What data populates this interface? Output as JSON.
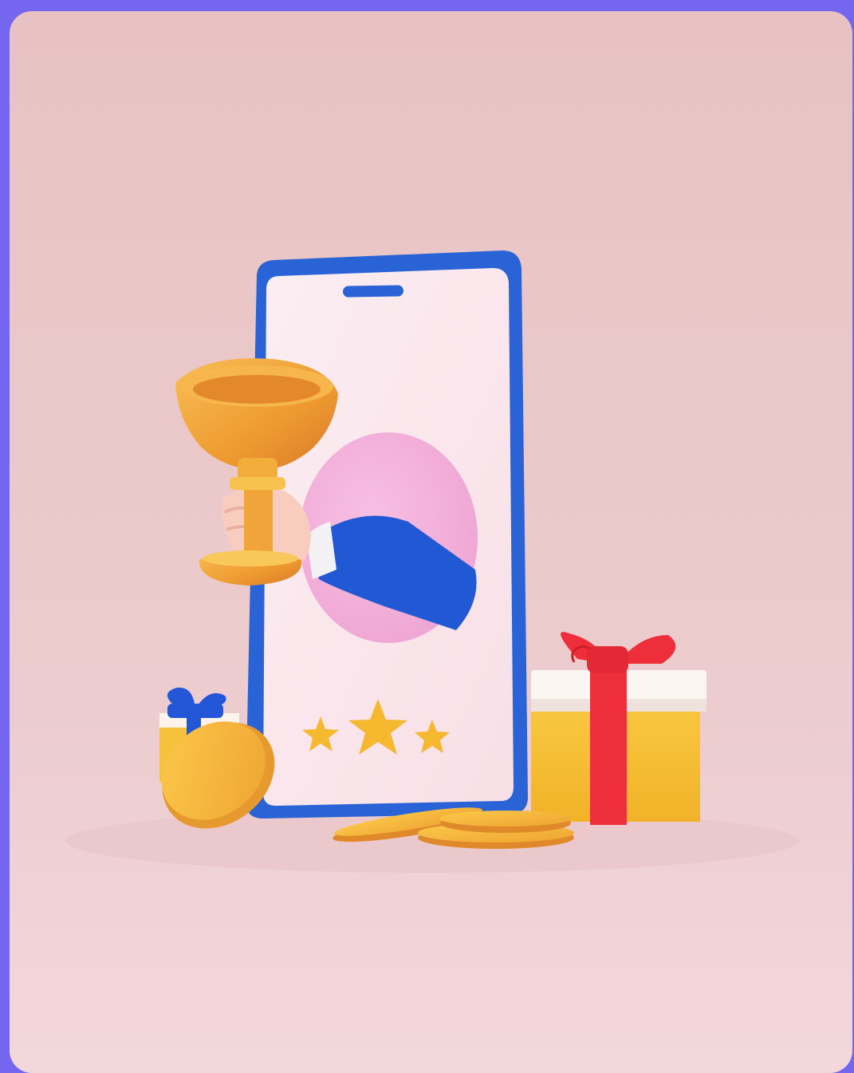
{
  "scene": {
    "illustration": "trophy-reward-illustration",
    "colors": {
      "frame": "#7466ee",
      "background_top": "#e8c4c3",
      "background_bottom": "#f3d7da",
      "phone_body": "#2a63d6",
      "phone_screen": "#fbe6ec",
      "portal": "#f4b3dc",
      "sleeve": "#2158d3",
      "trophy_gold": "#f0a43a",
      "coin_gold": "#f5b53a",
      "gift_yellow": "#f6bd2f",
      "gift_ribbon": "#ee2f3b",
      "gift_blue_ribbon": "#2456d8"
    },
    "elements": {
      "phone": "smartphone-icon",
      "trophy": "trophy-icon",
      "hand": "hand-icon",
      "stars": [
        "star-icon",
        "star-icon",
        "star-icon"
      ],
      "gift_large": "gift-box-icon",
      "gift_small": "gift-box-icon",
      "coins": [
        "coin-icon",
        "coin-icon",
        "coin-icon"
      ]
    }
  }
}
